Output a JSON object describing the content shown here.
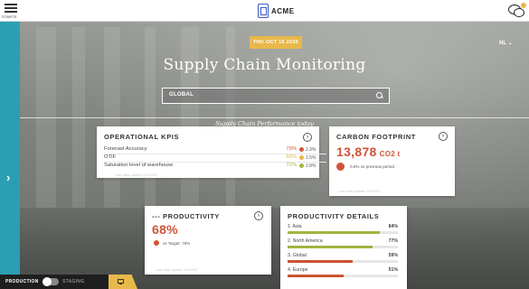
{
  "header": {
    "menu_label": "STARTS",
    "logo_text": "ACME"
  },
  "hero": {
    "date": "THU OCT 15 2020",
    "lang": "NL",
    "title": "Supply Chain Monitoring",
    "search_value": "GLOBAL",
    "subtitle": "Supply Chain Performance today"
  },
  "kpi_card": {
    "title": "OPERATIONAL KPIS",
    "rows": [
      {
        "name": "Forecast Accuracy",
        "value": "79%",
        "value_color": "#d0543a",
        "dot_color": "#d0543a",
        "trend": "2.3%"
      },
      {
        "name": "OTIF",
        "value": "89%",
        "value_color": "#e8b84a",
        "dot_color": "#e8b84a",
        "trend": "1.5%"
      },
      {
        "name": "Saturation level of warehouse",
        "value": "72%",
        "value_color": "#9fb640",
        "dot_color": "#9fb640",
        "trend": "1.8%"
      }
    ],
    "footnote": "Last data update 13/10/20"
  },
  "carbon_card": {
    "title": "CARBON FOOTPRINT",
    "value": "13,878",
    "unit": "CO2 t",
    "delta": "0.8% vs previous period",
    "footnote": "Last data update 13/10/20"
  },
  "productivity_card": {
    "title": "--- PRODUCTIVITY",
    "value": "68%",
    "note": "vs Target: 75%",
    "footnote": "Last data update 13/10/20"
  },
  "details_card": {
    "title": "PRODUCTIVITY DETAILS",
    "rows": [
      {
        "name": "1. Asia",
        "value": "84%",
        "fill": 0.84,
        "color": "#9fb640"
      },
      {
        "name": "2. North America",
        "value": "77%",
        "fill": 0.77,
        "color": "#9fb640"
      },
      {
        "name": "3. Global",
        "value": "59%",
        "fill": 0.59,
        "color": "#c8542f"
      },
      {
        "name": "4. Europe",
        "value": "51%",
        "fill": 0.51,
        "color": "#c8542f"
      }
    ]
  },
  "footer": {
    "production_label": "PRODUCTION",
    "staging_label": "STAGING"
  },
  "colors": {
    "teal": "#2a9fb3",
    "yellow": "#e8b84a",
    "red": "#d0543a",
    "green": "#9fb640"
  }
}
